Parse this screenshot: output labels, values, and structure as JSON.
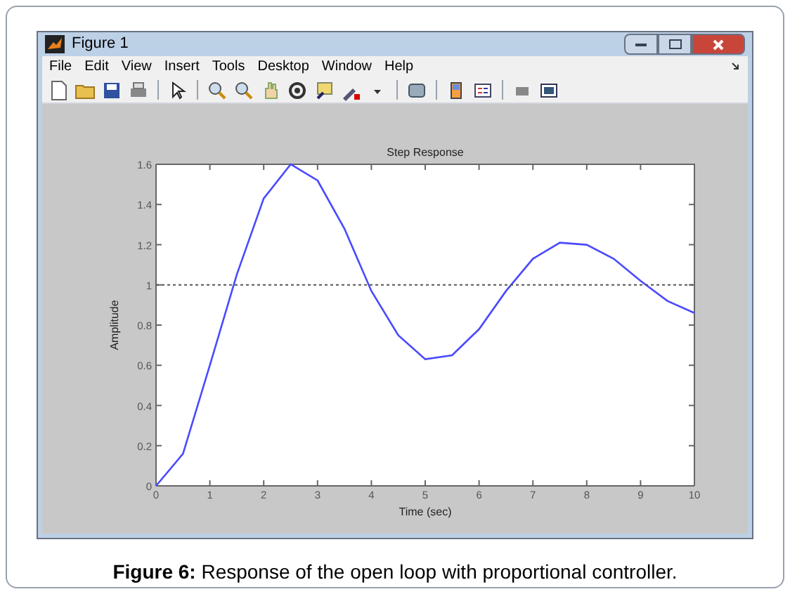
{
  "window": {
    "title": "Figure 1"
  },
  "menu": [
    "File",
    "Edit",
    "View",
    "Insert",
    "Tools",
    "Desktop",
    "Window",
    "Help"
  ],
  "plot": {
    "chart_data": {
      "type": "line",
      "title": "Step Response",
      "xlabel": "Time (sec)",
      "ylabel": "Amplitude",
      "x": [
        0,
        0.5,
        1,
        1.5,
        2,
        2.5,
        3,
        3.5,
        4,
        4.5,
        5,
        5.5,
        6,
        6.5,
        7,
        7.5,
        8,
        8.5,
        9,
        9.5,
        10
      ],
      "series": [
        {
          "color": "#4a4aff",
          "line_style": "solid",
          "values": [
            0,
            0.16,
            0.6,
            1.05,
            1.43,
            1.6,
            1.52,
            1.28,
            0.97,
            0.75,
            0.63,
            0.65,
            0.78,
            0.97,
            1.13,
            1.21,
            1.2,
            1.13,
            1.02,
            0.92,
            0.86
          ]
        },
        {
          "color": "#555555",
          "line_style": "dashed",
          "values": [
            1,
            1,
            1,
            1,
            1,
            1,
            1,
            1,
            1,
            1,
            1,
            1,
            1,
            1,
            1,
            1,
            1,
            1,
            1,
            1,
            1
          ]
        }
      ],
      "xlim": [
        0,
        10
      ],
      "ylim": [
        0,
        1.6
      ],
      "xticks": [
        0,
        1,
        2,
        3,
        4,
        5,
        6,
        7,
        8,
        9,
        10
      ],
      "yticks": [
        0,
        0.2,
        0.4,
        0.6,
        0.8,
        1,
        1.2,
        1.4,
        1.6
      ]
    }
  },
  "caption": "**Figure 6:** Response of the open loop with proportional controller."
}
